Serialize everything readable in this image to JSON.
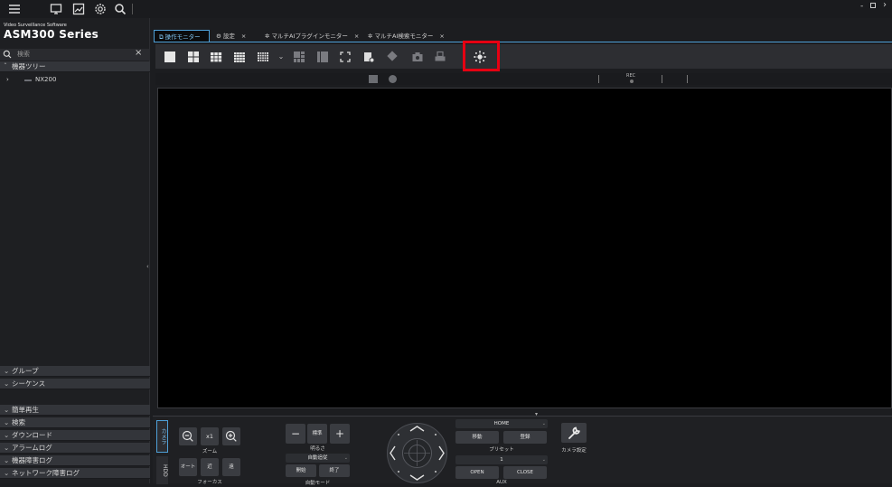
{
  "brand": {
    "subtitle": "Video Surveillance Software",
    "title": "ASM300 Series"
  },
  "search": {
    "placeholder": "検索",
    "close": "×"
  },
  "tree": {
    "header": "機器ツリー",
    "items": [
      {
        "label": "NX200"
      }
    ]
  },
  "sidebar_sections": [
    "グループ",
    "シーケンス",
    "簡単再生",
    "検索",
    "ダウンロード",
    "アラームログ",
    "機器障害ログ",
    "ネットワーク障害ログ"
  ],
  "tabs": [
    {
      "label": "操作モニター"
    },
    {
      "label": "設定"
    },
    {
      "label": "マルチAIプラグインモニター"
    },
    {
      "label": "マルチAI検索モニター"
    }
  ],
  "tab_close": "×",
  "info": {
    "rec": "REC"
  },
  "camera_controls": {
    "vtab_camera": "カメラ",
    "vtab_hdd": "HDD",
    "zoom": {
      "x1": "x1",
      "label": "ズーム"
    },
    "focus": {
      "auto": "オート",
      "near": "近",
      "far": "遠",
      "label": "フォーカス"
    },
    "brightness": {
      "minus": "−",
      "standard": "標準",
      "plus": "+",
      "label": "明るさ"
    },
    "auto_mode": {
      "selected": "自動追従",
      "start": "開始",
      "end": "終了",
      "label": "自動モード"
    },
    "preset": {
      "selected": "HOME",
      "move": "移動",
      "register": "登録",
      "label": "プリセット"
    },
    "aux": {
      "selected": "1",
      "open": "OPEN",
      "close": "CLOSE",
      "label": "AUX"
    },
    "camera_settings": "カメラ設定"
  },
  "colors": {
    "accent": "#4ea0d8",
    "highlight": "#e60012"
  }
}
